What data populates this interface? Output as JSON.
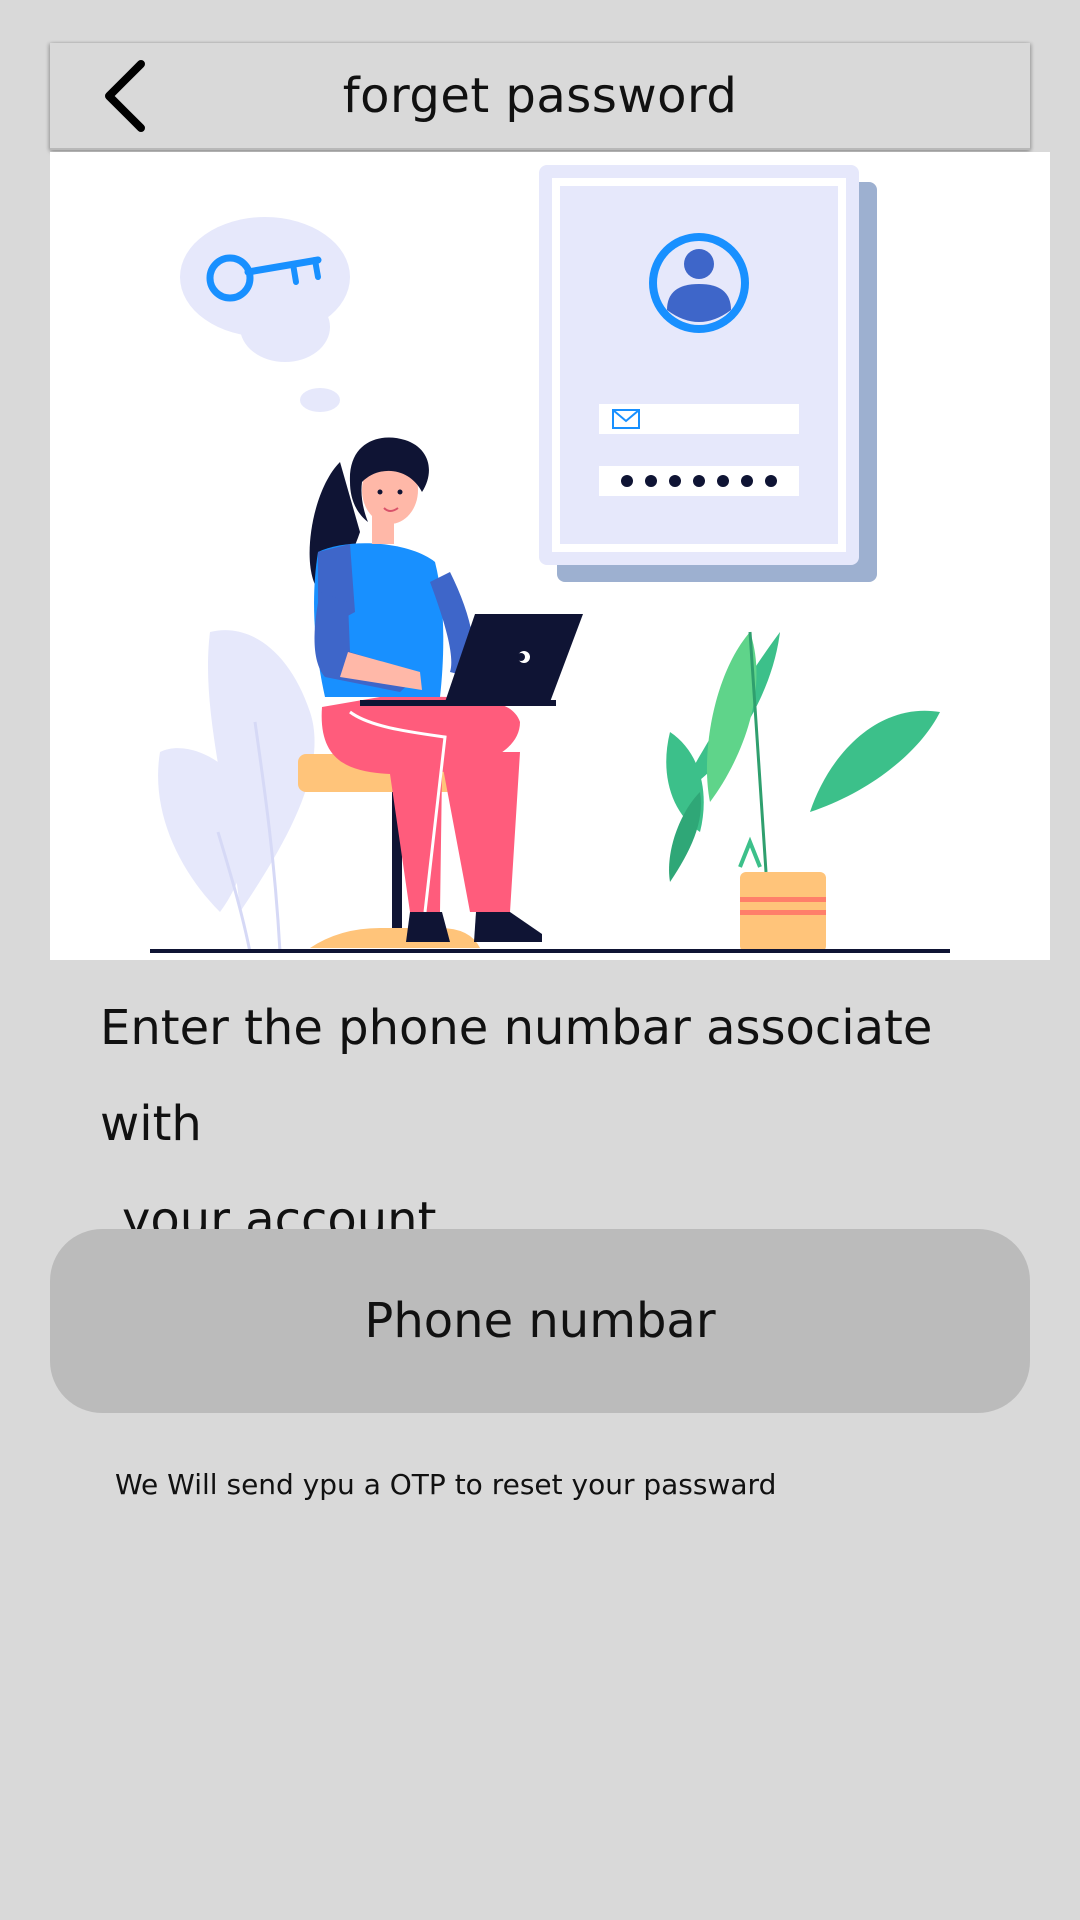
{
  "header": {
    "title": "forget password",
    "back_icon": "chevron-left-icon"
  },
  "illustration": {
    "name": "forgot-password-illustration",
    "colors": {
      "accent_blue": "#1890ff",
      "card_bg": "#e6e8fb",
      "plant_green": "#3cc08a",
      "pants_pink": "#ff5c7c",
      "laptop": "#0f1434"
    }
  },
  "instruction": {
    "line1": "Enter the phone numbar associate with",
    "line2": "your account"
  },
  "phone_input": {
    "placeholder": "Phone numbar",
    "value": ""
  },
  "hint": "We Will send ypu a OTP to reset your passward",
  "colors": {
    "background": "#d9d9d9",
    "input_bg": "#bbbbbb",
    "text": "#111111"
  }
}
